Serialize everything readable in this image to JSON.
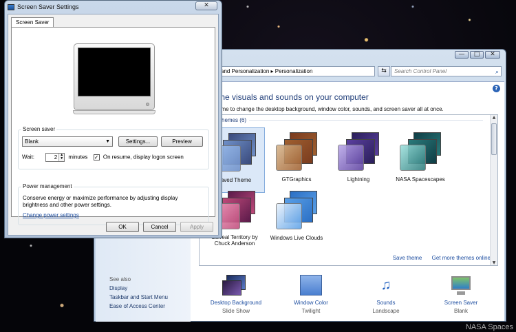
{
  "desktop": {
    "watermark": "NASA Spaces"
  },
  "control_panel": {
    "address": "and Personalization  ▸  Personalization",
    "search_placeholder": "Search Control Panel",
    "title": "the visuals and sounds on your computer",
    "description": "eme to change the desktop background, window color, sounds, and screen saver all at once.",
    "group_label": "hemes (6)",
    "themes": [
      {
        "name": "saved Theme",
        "colors": [
          "#3a4a7c",
          "#6f90c8",
          "#9ec0ef"
        ]
      },
      {
        "name": "GTGraphics",
        "colors": [
          "#7a3b1e",
          "#a06030",
          "#d6b48a"
        ]
      },
      {
        "name": "Lightning",
        "colors": [
          "#2a1f5a",
          "#5b3f9f",
          "#b8a6e8"
        ]
      },
      {
        "name": "NASA Spacescapes",
        "colors": [
          "#0f3d45",
          "#2a7a7a",
          "#9ce0dc"
        ]
      },
      {
        "name": "Surreal Territory by\nChuck Anderson",
        "colors": [
          "#5a1a4a",
          "#c04a7a",
          "#f0a0c0"
        ]
      },
      {
        "name": "Windows Live Clouds",
        "colors": [
          "#2b6fc4",
          "#5aa0e8",
          "#e8f1fb"
        ]
      }
    ],
    "save_theme": "Save theme",
    "get_more": "Get more themes online",
    "see_also": {
      "heading": "See also",
      "links": [
        "Display",
        "Taskbar and Start Menu",
        "Ease of Access Center"
      ]
    },
    "bottom": [
      {
        "title": "Desktop Background",
        "sub": "Slide Show"
      },
      {
        "title": "Window Color",
        "sub": "Twilight"
      },
      {
        "title": "Sounds",
        "sub": "Landscape"
      },
      {
        "title": "Screen Saver",
        "sub": "Blank"
      }
    ],
    "window_controls": {
      "minimize": "—",
      "maximize": "□",
      "close": "✕"
    }
  },
  "screen_saver_dialog": {
    "title": "Screen Saver Settings",
    "close": "✕",
    "tab": "Screen Saver",
    "group_label": "Screen saver",
    "selected": "Blank",
    "settings_btn": "Settings...",
    "preview_btn": "Preview",
    "wait_label": "Wait:",
    "wait_value": "2",
    "minutes_label": "minutes",
    "logon_checked": true,
    "logon_label": "On resume, display logon screen",
    "power_label": "Power management",
    "power_text": "Conserve energy or maximize performance by adjusting display brightness and other power settings.",
    "power_link": "Change power settings",
    "ok": "OK",
    "cancel": "Cancel",
    "apply": "Apply"
  }
}
